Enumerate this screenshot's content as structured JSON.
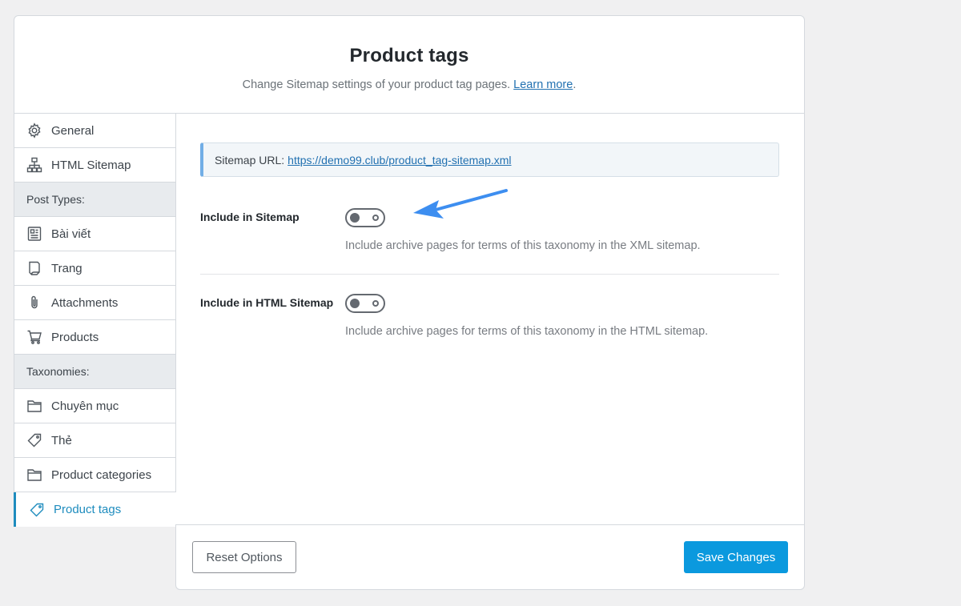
{
  "header": {
    "title": "Product tags",
    "description": "Change Sitemap settings of your product tag pages.",
    "learn_more": "Learn more",
    "period": "."
  },
  "sidebar": {
    "items": [
      {
        "label": "General",
        "icon": "gear-icon"
      },
      {
        "label": "HTML Sitemap",
        "icon": "sitemap-icon"
      }
    ],
    "post_types_heading": "Post Types:",
    "post_types": [
      {
        "label": "Bài viết",
        "icon": "post-icon"
      },
      {
        "label": "Trang",
        "icon": "page-icon"
      },
      {
        "label": "Attachments",
        "icon": "paperclip-icon"
      },
      {
        "label": "Products",
        "icon": "cart-icon"
      }
    ],
    "taxonomies_heading": "Taxonomies:",
    "taxonomies": [
      {
        "label": "Chuyên mục",
        "icon": "folder-icon"
      },
      {
        "label": "Thẻ",
        "icon": "tag-icon"
      },
      {
        "label": "Product categories",
        "icon": "folder-icon"
      },
      {
        "label": "Product tags",
        "icon": "tag-icon",
        "active": true
      }
    ]
  },
  "content": {
    "sitemap_url_label": "Sitemap URL:",
    "sitemap_url": "https://demo99.club/product_tag-sitemap.xml",
    "include_sitemap": {
      "label": "Include in Sitemap",
      "enabled": false,
      "description": "Include archive pages for terms of this taxonomy in the XML sitemap."
    },
    "include_html_sitemap": {
      "label": "Include in HTML Sitemap",
      "enabled": false,
      "description": "Include archive pages for terms of this taxonomy in the HTML sitemap."
    }
  },
  "footer": {
    "reset_label": "Reset Options",
    "save_label": "Save Changes"
  },
  "colors": {
    "accent": "#1e8cbe",
    "save_button": "#0b99de",
    "link": "#2271b1",
    "arrow": "#3d8ef0"
  }
}
